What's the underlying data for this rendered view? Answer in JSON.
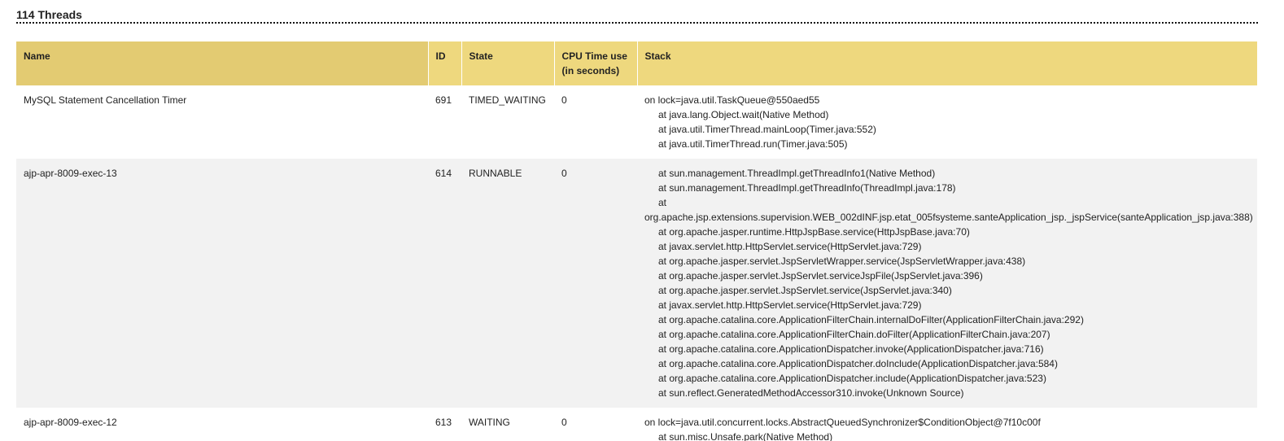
{
  "section": {
    "title": "114 Threads"
  },
  "table": {
    "headers": {
      "name": "Name",
      "id": "ID",
      "state": "State",
      "cpu_line1": "CPU Time use",
      "cpu_line2": "(in seconds)",
      "stack": "Stack"
    },
    "rows": [
      {
        "name": "MySQL Statement Cancellation Timer",
        "id": "691",
        "state": "TIMED_WAITING",
        "cpu": "0",
        "stack": [
          "on lock=java.util.TaskQueue@550aed55",
          "at java.lang.Object.wait(Native Method)",
          "at java.util.TimerThread.mainLoop(Timer.java:552)",
          "at java.util.TimerThread.run(Timer.java:505)"
        ]
      },
      {
        "name": "ajp-apr-8009-exec-13",
        "id": "614",
        "state": "RUNNABLE",
        "cpu": "0",
        "stack": [
          "at sun.management.ThreadImpl.getThreadInfo1(Native Method)",
          "at sun.management.ThreadImpl.getThreadInfo(ThreadImpl.java:178)",
          "at",
          "org.apache.jsp.extensions.supervision.WEB_002dINF.jsp.etat_005fsysteme.santeApplication_jsp._jspService(santeApplication_jsp.java:388)",
          "at org.apache.jasper.runtime.HttpJspBase.service(HttpJspBase.java:70)",
          "at javax.servlet.http.HttpServlet.service(HttpServlet.java:729)",
          "at org.apache.jasper.servlet.JspServletWrapper.service(JspServletWrapper.java:438)",
          "at org.apache.jasper.servlet.JspServlet.serviceJspFile(JspServlet.java:396)",
          "at org.apache.jasper.servlet.JspServlet.service(JspServlet.java:340)",
          "at javax.servlet.http.HttpServlet.service(HttpServlet.java:729)",
          "at org.apache.catalina.core.ApplicationFilterChain.internalDoFilter(ApplicationFilterChain.java:292)",
          "at org.apache.catalina.core.ApplicationFilterChain.doFilter(ApplicationFilterChain.java:207)",
          "at org.apache.catalina.core.ApplicationDispatcher.invoke(ApplicationDispatcher.java:716)",
          "at org.apache.catalina.core.ApplicationDispatcher.doInclude(ApplicationDispatcher.java:584)",
          "at org.apache.catalina.core.ApplicationDispatcher.include(ApplicationDispatcher.java:523)",
          "at sun.reflect.GeneratedMethodAccessor310.invoke(Unknown Source)"
        ]
      },
      {
        "name": "ajp-apr-8009-exec-12",
        "id": "613",
        "state": "WAITING",
        "cpu": "0",
        "stack": [
          "on lock=java.util.concurrent.locks.AbstractQueuedSynchronizer$ConditionObject@7f10c00f",
          "at sun.misc.Unsafe.park(Native Method)"
        ]
      }
    ]
  }
}
